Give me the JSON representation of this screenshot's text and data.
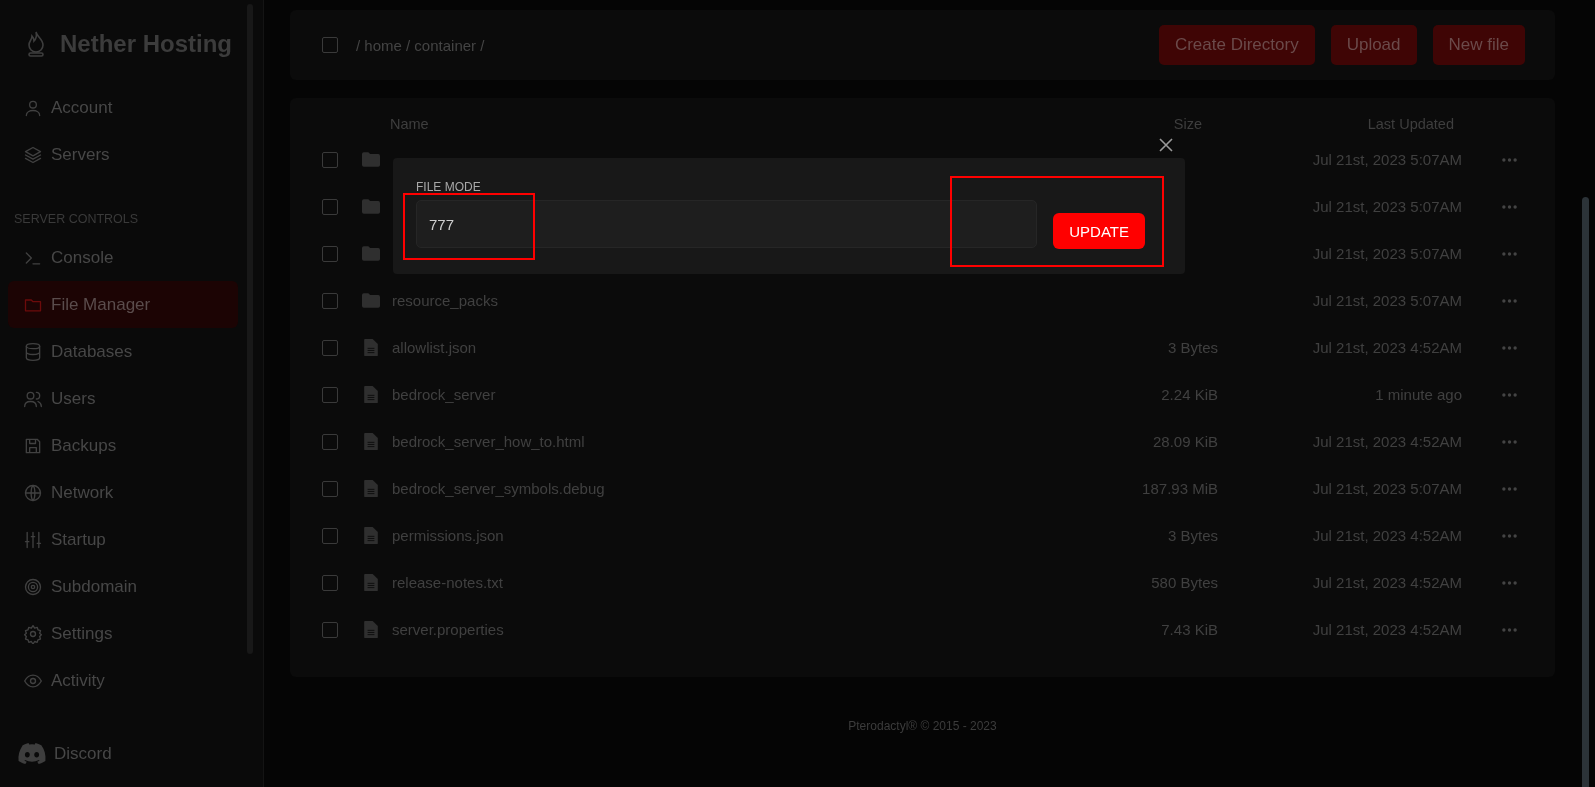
{
  "brand": {
    "name": "Nether Hosting"
  },
  "nav": [
    {
      "label": "Account",
      "selected": false
    },
    {
      "label": "Servers",
      "selected": false
    }
  ],
  "section_label": "SERVER CONTROLS",
  "controls": [
    {
      "label": "Console",
      "selected": false
    },
    {
      "label": "File Manager",
      "selected": true
    },
    {
      "label": "Databases",
      "selected": false
    },
    {
      "label": "Users",
      "selected": false
    },
    {
      "label": "Backups",
      "selected": false
    },
    {
      "label": "Network",
      "selected": false
    },
    {
      "label": "Startup",
      "selected": false
    },
    {
      "label": "Subdomain",
      "selected": false
    },
    {
      "label": "Settings",
      "selected": false
    },
    {
      "label": "Activity",
      "selected": false
    }
  ],
  "discord": {
    "label": "Discord"
  },
  "toolbar": {
    "select_all": {
      "checked": false
    },
    "breadcrumb": "/ home / container /",
    "buttons": [
      "Create Directory",
      "Upload",
      "New file"
    ]
  },
  "table": {
    "columns": [
      "Name",
      "Size",
      "Last Updated"
    ],
    "rows": [
      {
        "kind": "folder",
        "checked": false,
        "name": "",
        "size": "",
        "updated": "Jul 21st, 2023 5:07AM"
      },
      {
        "kind": "folder",
        "checked": false,
        "name": "",
        "size": "",
        "updated": "Jul 21st, 2023 5:07AM"
      },
      {
        "kind": "folder",
        "checked": false,
        "name": "",
        "size": "",
        "updated": "Jul 21st, 2023 5:07AM"
      },
      {
        "kind": "folder",
        "checked": false,
        "name": "resource_packs",
        "size": "",
        "updated": "Jul 21st, 2023 5:07AM"
      },
      {
        "kind": "file",
        "checked": false,
        "name": "allowlist.json",
        "size": "3 Bytes",
        "updated": "Jul 21st, 2023 4:52AM"
      },
      {
        "kind": "file",
        "checked": false,
        "name": "bedrock_server",
        "size": "2.24 KiB",
        "updated": "1 minute ago"
      },
      {
        "kind": "file",
        "checked": false,
        "name": "bedrock_server_how_to.html",
        "size": "28.09 KiB",
        "updated": "Jul 21st, 2023 4:52AM"
      },
      {
        "kind": "file",
        "checked": false,
        "name": "bedrock_server_symbols.debug",
        "size": "187.93 MiB",
        "updated": "Jul 21st, 2023 5:07AM"
      },
      {
        "kind": "file",
        "checked": false,
        "name": "permissions.json",
        "size": "3 Bytes",
        "updated": "Jul 21st, 2023 4:52AM"
      },
      {
        "kind": "file",
        "checked": false,
        "name": "release-notes.txt",
        "size": "580 Bytes",
        "updated": "Jul 21st, 2023 4:52AM"
      },
      {
        "kind": "file",
        "checked": false,
        "name": "server.properties",
        "size": "7.43 KiB",
        "updated": "Jul 21st, 2023 4:52AM"
      }
    ]
  },
  "modal": {
    "label": "FILE MODE",
    "value": "777",
    "button": "UPDATE"
  },
  "footer": "Pterodactyl® © 2015 - 2023"
}
